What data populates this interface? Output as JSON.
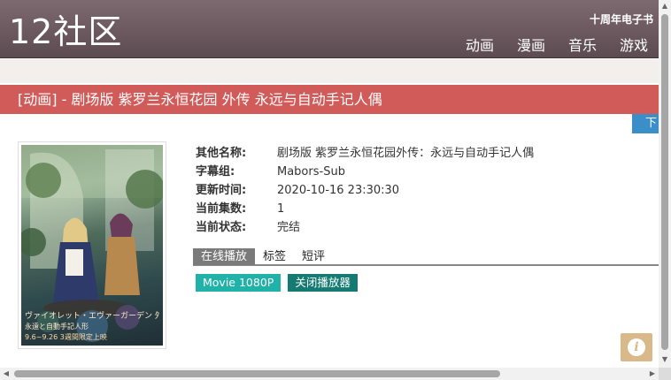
{
  "header": {
    "logo_num": "12",
    "logo_text": "社区",
    "anniversary": "十周年电子书",
    "nav": [
      {
        "label": "动画"
      },
      {
        "label": "漫画"
      },
      {
        "label": "音乐"
      },
      {
        "label": "游戏"
      }
    ]
  },
  "title_bar": "[动画] - 剧场版 紫罗兰永恒花园 外传 永远与自动手记人偶",
  "download_tab": "下",
  "poster": {
    "text_line1": "ヴァイオレット・エヴァーガーデン 外伝",
    "text_line2": "永遠と自動手記人形",
    "text_line3": "9.6~9.26 3週間限定上映"
  },
  "info": [
    {
      "label": "其他名称:",
      "value": "剧场版 紫罗兰永恒花园外传：永远与自动手记人偶"
    },
    {
      "label": "字幕组:",
      "value": "Mabors-Sub"
    },
    {
      "label": "更新时间:",
      "value": "2020-10-16 23:30:30"
    },
    {
      "label": "当前集数:",
      "value": "1"
    },
    {
      "label": "当前状态:",
      "value": "完结"
    }
  ],
  "tabs": [
    {
      "label": "在线播放"
    },
    {
      "label": "标签"
    },
    {
      "label": "短评"
    }
  ],
  "episode_button": "Movie 1080P",
  "close_player_button": "关闭播放器",
  "colors": {
    "header": "#6b5a60",
    "title_bar": "#d05b59",
    "episode_btn": "#20b2a8",
    "close_btn": "#147a72",
    "download_tab": "#3a8fc9",
    "info_fab": "#d9b88a"
  },
  "icons": {
    "info": "info-icon"
  }
}
